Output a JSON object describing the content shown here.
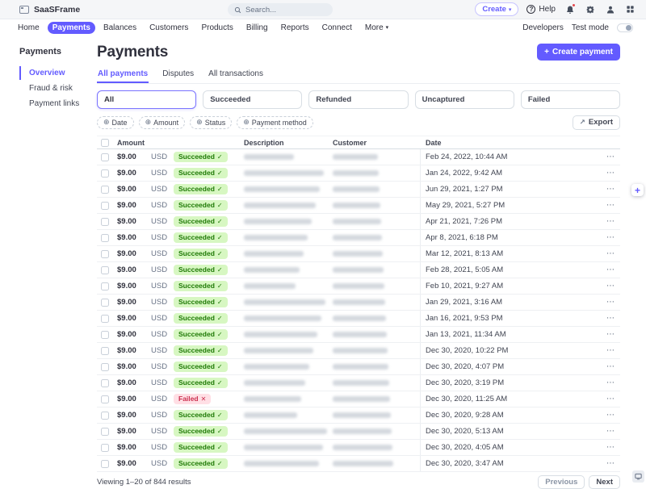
{
  "glyphs": {
    "plus": "+",
    "caret": "▾",
    "help": "?",
    "plus_circle": "⊕",
    "check": "✓",
    "cross": "✕",
    "export": "↗",
    "dots": "⋯"
  },
  "topbar": {
    "app_name": "SaaSFrame",
    "search_placeholder": "Search...",
    "create_label": "Create",
    "help_label": "Help"
  },
  "nav": {
    "items": [
      "Home",
      "Payments",
      "Balances",
      "Customers",
      "Products",
      "Billing",
      "Reports",
      "Connect",
      "More"
    ],
    "active": "Payments",
    "developers": "Developers",
    "test_mode": "Test mode"
  },
  "sidebar": {
    "title": "Payments",
    "items": [
      {
        "label": "Overview",
        "active": true
      },
      {
        "label": "Fraud & risk",
        "active": false
      },
      {
        "label": "Payment links",
        "active": false
      }
    ]
  },
  "main": {
    "title": "Payments",
    "create_button_label": "Create payment",
    "tabs": [
      "All payments",
      "Disputes",
      "All transactions"
    ],
    "active_tab": "All payments",
    "status_filters": [
      "All",
      "Succeeded",
      "Refunded",
      "Uncaptured",
      "Failed"
    ],
    "active_filter": "All",
    "filter_chips": [
      "Date",
      "Amount",
      "Status",
      "Payment method"
    ],
    "export_label": "Export",
    "table": {
      "columns": [
        "Amount",
        "Description",
        "Customer",
        "Date"
      ],
      "rows": [
        {
          "amount": "$9.00",
          "currency": "USD",
          "status": "Succeeded",
          "date": "Feb 24, 2022, 10:44 AM"
        },
        {
          "amount": "$9.00",
          "currency": "USD",
          "status": "Succeeded",
          "date": "Jan 24, 2022, 9:42 AM"
        },
        {
          "amount": "$9.00",
          "currency": "USD",
          "status": "Succeeded",
          "date": "Jun 29, 2021, 1:27 PM"
        },
        {
          "amount": "$9.00",
          "currency": "USD",
          "status": "Succeeded",
          "date": "May 29, 2021, 5:27 PM"
        },
        {
          "amount": "$9.00",
          "currency": "USD",
          "status": "Succeeded",
          "date": "Apr 21, 2021, 7:26 PM"
        },
        {
          "amount": "$9.00",
          "currency": "USD",
          "status": "Succeeded",
          "date": "Apr 8, 2021, 6:18 PM"
        },
        {
          "amount": "$9.00",
          "currency": "USD",
          "status": "Succeeded",
          "date": "Mar 12, 2021, 8:13 AM"
        },
        {
          "amount": "$9.00",
          "currency": "USD",
          "status": "Succeeded",
          "date": "Feb 28, 2021, 5:05 AM"
        },
        {
          "amount": "$9.00",
          "currency": "USD",
          "status": "Succeeded",
          "date": "Feb 10, 2021, 9:27 AM"
        },
        {
          "amount": "$9.00",
          "currency": "USD",
          "status": "Succeeded",
          "date": "Jan 29, 2021, 3:16 AM"
        },
        {
          "amount": "$9.00",
          "currency": "USD",
          "status": "Succeeded",
          "date": "Jan 16, 2021, 9:53 PM"
        },
        {
          "amount": "$9.00",
          "currency": "USD",
          "status": "Succeeded",
          "date": "Jan 13, 2021, 11:34 AM"
        },
        {
          "amount": "$9.00",
          "currency": "USD",
          "status": "Succeeded",
          "date": "Dec 30, 2020, 10:22 PM"
        },
        {
          "amount": "$9.00",
          "currency": "USD",
          "status": "Succeeded",
          "date": "Dec 30, 2020, 4:07 PM"
        },
        {
          "amount": "$9.00",
          "currency": "USD",
          "status": "Succeeded",
          "date": "Dec 30, 2020, 3:19 PM"
        },
        {
          "amount": "$9.00",
          "currency": "USD",
          "status": "Failed",
          "date": "Dec 30, 2020, 11:25 AM"
        },
        {
          "amount": "$9.00",
          "currency": "USD",
          "status": "Succeeded",
          "date": "Dec 30, 2020, 9:28 AM"
        },
        {
          "amount": "$9.00",
          "currency": "USD",
          "status": "Succeeded",
          "date": "Dec 30, 2020, 5:13 AM"
        },
        {
          "amount": "$9.00",
          "currency": "USD",
          "status": "Succeeded",
          "date": "Dec 30, 2020, 4:05 AM"
        },
        {
          "amount": "$9.00",
          "currency": "USD",
          "status": "Succeeded",
          "date": "Dec 30, 2020, 3:47 AM"
        }
      ]
    },
    "footer": {
      "summary": "Viewing 1–20 of 844 results",
      "previous": "Previous",
      "next": "Next"
    }
  },
  "colors": {
    "accent": "#635bff",
    "success_bg": "#d7f7c2",
    "success_text": "#1f7a06",
    "failed_bg": "#ffdfe5",
    "failed_text": "#cb2f4f",
    "notification_dot": "#e5484d"
  }
}
